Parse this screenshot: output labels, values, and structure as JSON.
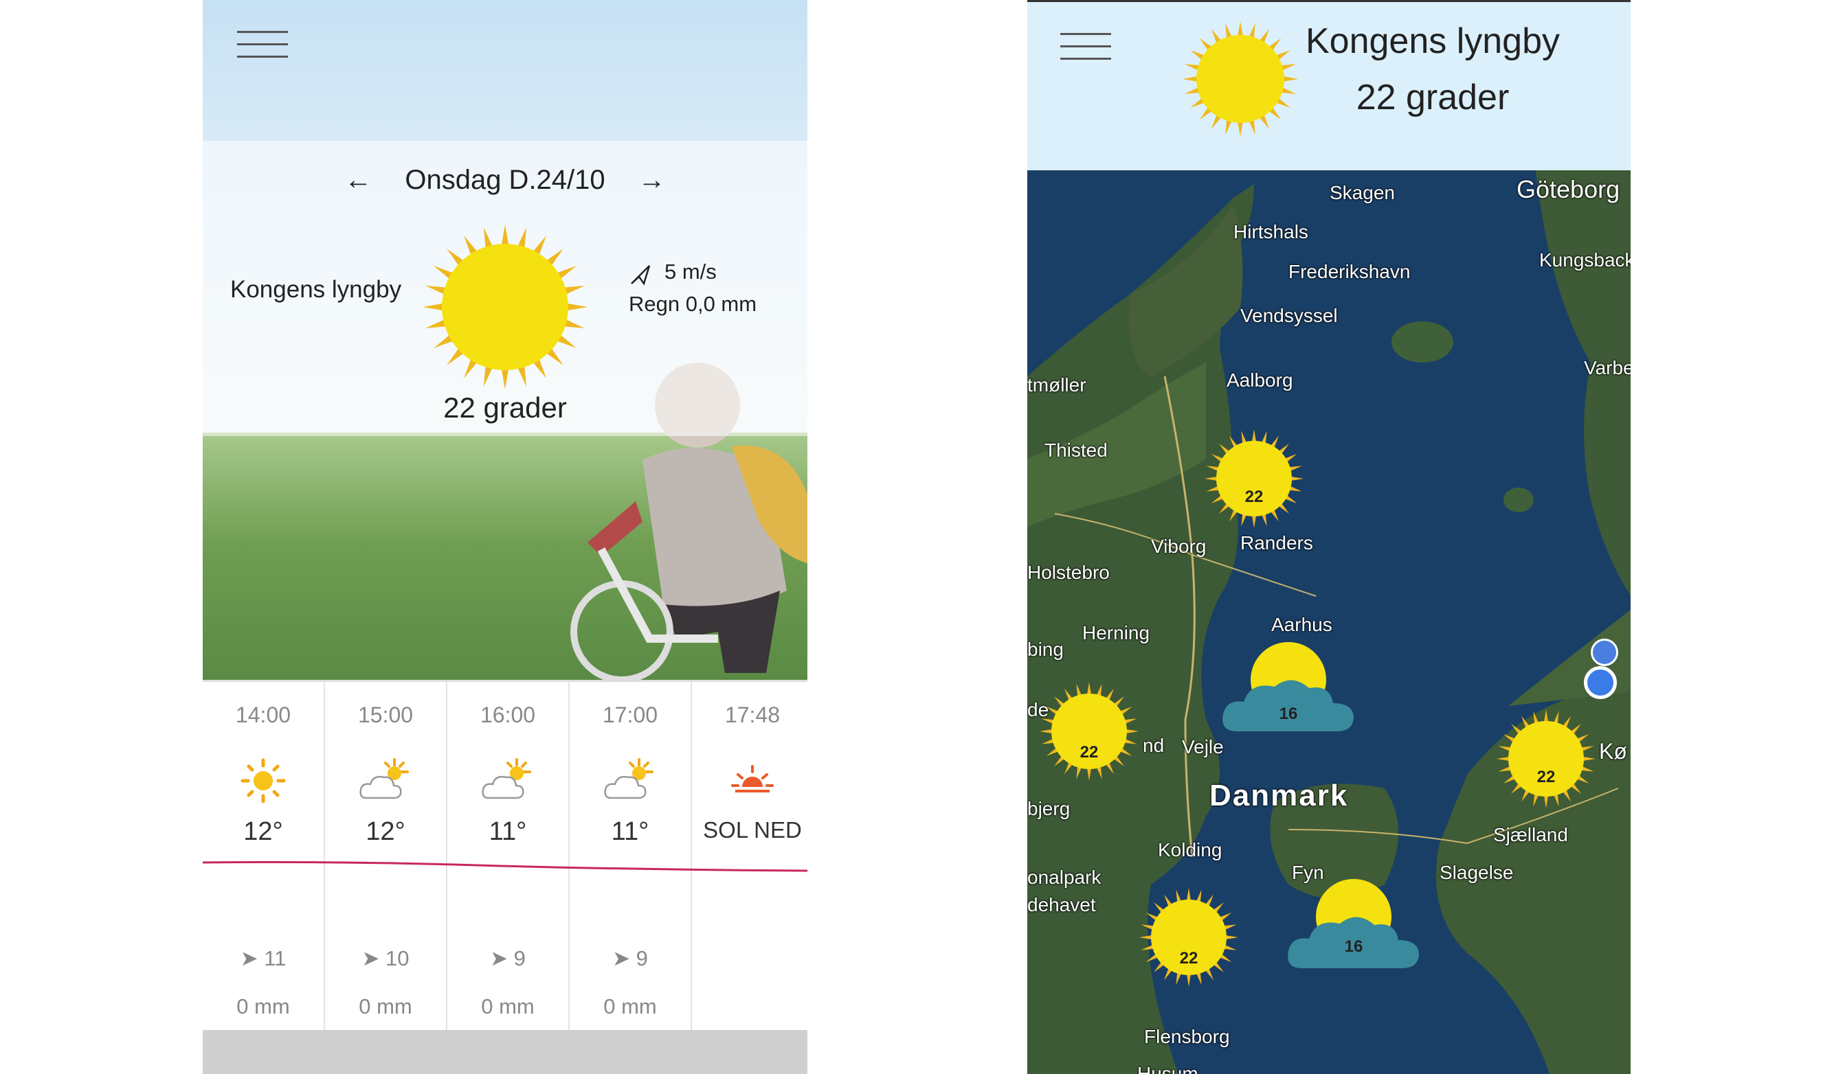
{
  "left_phone": {
    "date_nav": {
      "prev": "←",
      "label": "Onsdag D.24/10",
      "next": "→"
    },
    "city": "Kongens lyngby",
    "temperature": "22 grader",
    "wind": "5 m/s",
    "rain": "Regn 0,0 mm",
    "forecast": [
      {
        "time": "14:00",
        "icon": "sun-icon",
        "temp": "12°",
        "wind": "11",
        "rain": "0 mm"
      },
      {
        "time": "15:00",
        "icon": "partly-cloudy-icon",
        "temp": "12°",
        "wind": "10",
        "rain": "0 mm"
      },
      {
        "time": "16:00",
        "icon": "partly-cloudy-icon",
        "temp": "11°",
        "wind": "9",
        "rain": "0 mm"
      },
      {
        "time": "17:00",
        "icon": "partly-cloudy-icon",
        "temp": "11°",
        "wind": "9",
        "rain": "0 mm"
      },
      {
        "time": "17:48",
        "icon": "sunset-icon",
        "temp": "SOL NED",
        "wind": "",
        "rain": ""
      }
    ]
  },
  "right_phone": {
    "city": "Kongens lyngby",
    "temperature": "22 grader",
    "map_labels": [
      "Skagen",
      "Göteborg",
      "Hirtshals",
      "Frederikshavn",
      "Kungsback",
      "Vendsyssel",
      "Varbe",
      "tmøller",
      "Aalborg",
      "Thisted",
      "Viborg",
      "Randers",
      "Holstebro",
      "Aarhus",
      "Herning",
      "bing",
      "de",
      "nd",
      "Vejle",
      "Danmark",
      "bjerg",
      "Kolding",
      "onalpark",
      "dehavet",
      "Fyn",
      "Sjælland",
      "Slagelse",
      "Kø",
      "Flensborg",
      "Husum"
    ],
    "map_markers": [
      {
        "type": "sun",
        "value": "22"
      },
      {
        "type": "cloud",
        "value": "16"
      },
      {
        "type": "sun",
        "value": "22"
      },
      {
        "type": "sun",
        "value": "22"
      },
      {
        "type": "sun",
        "value": "22"
      },
      {
        "type": "cloud",
        "value": "16"
      }
    ]
  },
  "colors": {
    "sun": "#f5e10f",
    "sun_rays": "#f0b820",
    "cloud": "#3a8a9e",
    "header_blue": "#dcf0fb",
    "temp_line": "#c8285a"
  }
}
